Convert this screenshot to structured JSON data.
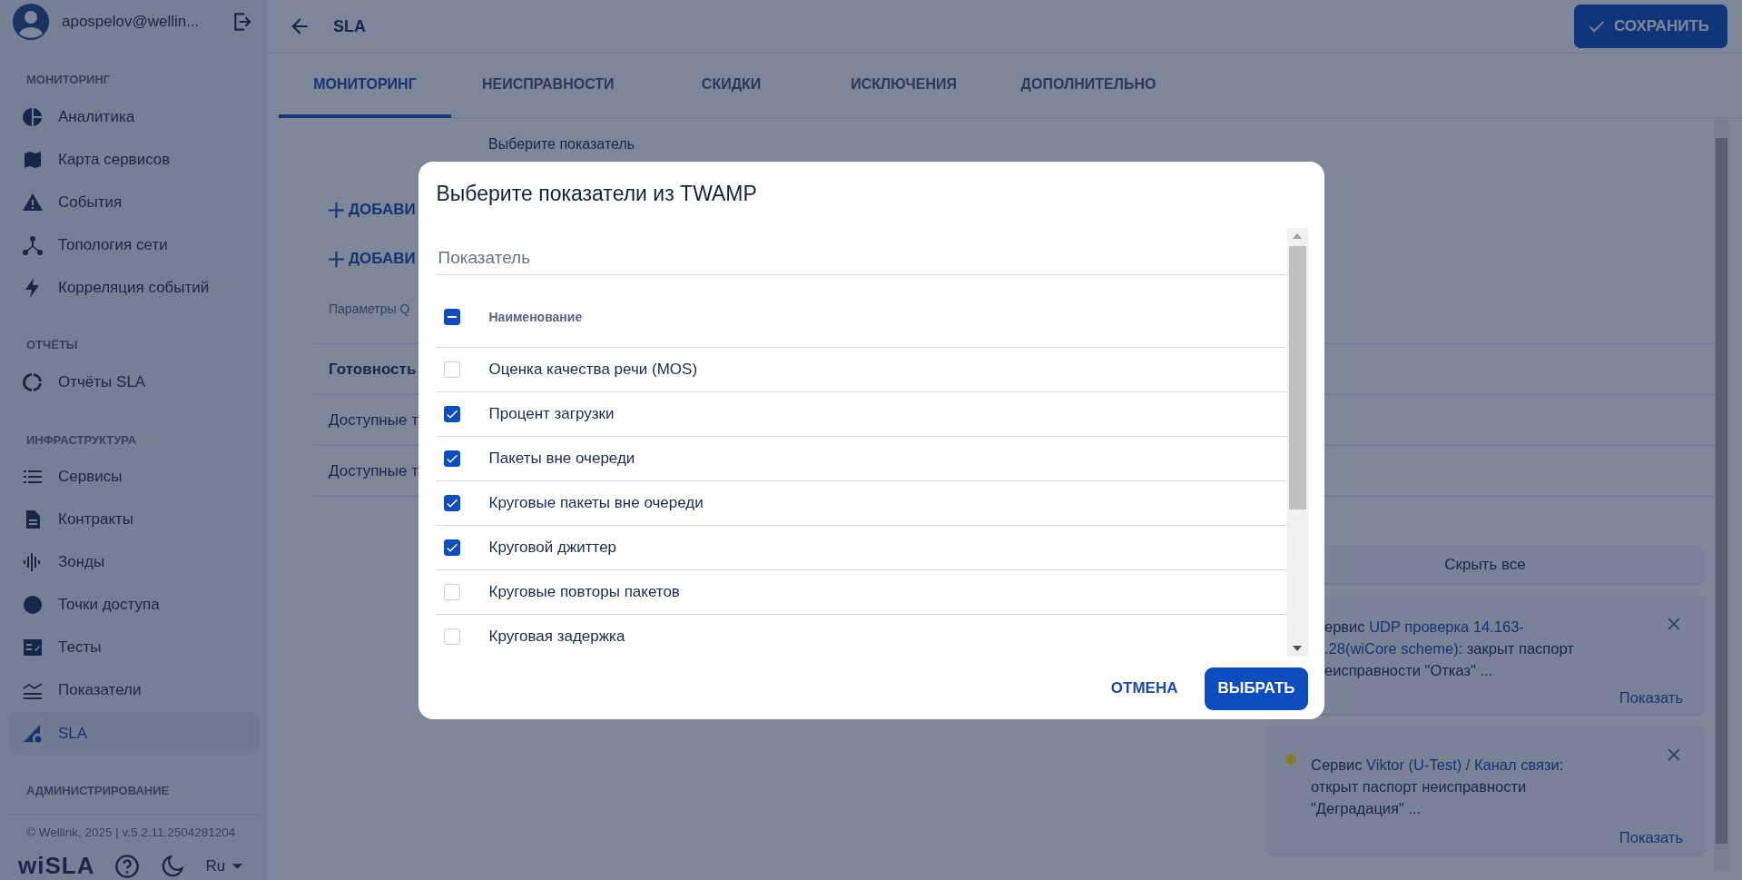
{
  "sidebar": {
    "user": "apospelov@wellin...",
    "sections": [
      {
        "title": "МОНИТОРИНГ",
        "items": [
          {
            "label": "Аналитика",
            "selected": false
          },
          {
            "label": "Карта сервисов",
            "selected": false
          },
          {
            "label": "События",
            "selected": false
          },
          {
            "label": "Топология сети",
            "selected": false
          },
          {
            "label": "Корреляция событий",
            "selected": false
          }
        ]
      },
      {
        "title": "ОТЧЁТЫ",
        "items": [
          {
            "label": "Отчёты SLA",
            "selected": false
          }
        ]
      },
      {
        "title": "ИНФРАСТРУКТУРА",
        "items": [
          {
            "label": "Сервисы",
            "selected": false
          },
          {
            "label": "Контракты",
            "selected": false
          },
          {
            "label": "Зонды",
            "selected": false
          },
          {
            "label": "Точки доступа",
            "selected": false
          },
          {
            "label": "Тесты",
            "selected": false
          },
          {
            "label": "Показатели",
            "selected": false
          },
          {
            "label": "SLA",
            "selected": true
          }
        ]
      },
      {
        "title": "АДМИНИСТРИРОВАНИЕ"
      }
    ],
    "footer": "© Wellink, 2025 | v.5.2.11.2504281204",
    "logo": "wiSLA",
    "language": "Ru"
  },
  "header": {
    "title": "SLA",
    "save_button": "СОХРАНИТЬ"
  },
  "tabs": [
    {
      "label": "МОНИТОРИНГ",
      "selected": true
    },
    {
      "label": "НЕИСПРАВНОСТИ",
      "selected": false
    },
    {
      "label": "СКИДКИ",
      "selected": false
    },
    {
      "label": "ИСКЛЮЧЕНИЯ",
      "selected": false
    },
    {
      "label": "ДОПОЛНИТЕЛЬНО",
      "selected": false
    }
  ],
  "content": {
    "metric_label": "Выберите показатель",
    "add_buttons": [
      "ДОБАВИ",
      "ДОБАВИ"
    ],
    "qos_label": "Параметры Q",
    "rows": [
      {
        "text": "Готовность",
        "bold": true
      },
      {
        "text": "Доступные т",
        "bold": false
      },
      {
        "text": "Доступные т",
        "bold": false
      }
    ]
  },
  "dialog": {
    "title": "Выберите показатели из TWAMP",
    "search": {
      "placeholder": "Показатель"
    },
    "header": {
      "label": "Наименование",
      "indeterminate": true
    },
    "rows": [
      {
        "label": "Оценка качества речи (MOS)",
        "checked": false
      },
      {
        "label": "Процент загрузки",
        "checked": true
      },
      {
        "label": "Пакеты вне очереди",
        "checked": true
      },
      {
        "label": "Круговые пакеты вне очереди",
        "checked": true
      },
      {
        "label": "Круговой джиттер",
        "checked": true
      },
      {
        "label": "Круговые повторы пакетов",
        "checked": false
      },
      {
        "label": "Круговая задержка",
        "checked": false
      }
    ],
    "cancel": "ОТМЕНА",
    "confirm": "ВЫБРАТЬ"
  },
  "notifications": {
    "hide_all": "Скрыть все",
    "items": [
      {
        "lines": [
          [
            {
              "kind": "plain",
              "text": "ервис "
            },
            {
              "kind": "link",
              "text": "UDP проверка 14.163-"
            }
          ],
          [
            {
              "kind": "link",
              "text": ".28(wiCore scheme)"
            },
            {
              "kind": "plain",
              "text": ": закрыт паспорт"
            }
          ],
          [
            {
              "kind": "plain",
              "text": "еисправности \"Отказ\" ..."
            }
          ]
        ],
        "action": "Показать",
        "covered": true
      },
      {
        "color": "#8a7a2e",
        "lines": [
          [
            {
              "kind": "plain",
              "text": "Сервис "
            },
            {
              "kind": "link",
              "text": "Viktor (U-Test) / Канал связи"
            },
            {
              "kind": "plain",
              "text": ":"
            }
          ],
          [
            {
              "kind": "plain",
              "text": "открыт паспорт неисправности"
            }
          ],
          [
            {
              "kind": "plain",
              "text": "\"Деградация\" ..."
            }
          ]
        ],
        "action": "Показать",
        "covered": false
      }
    ]
  }
}
